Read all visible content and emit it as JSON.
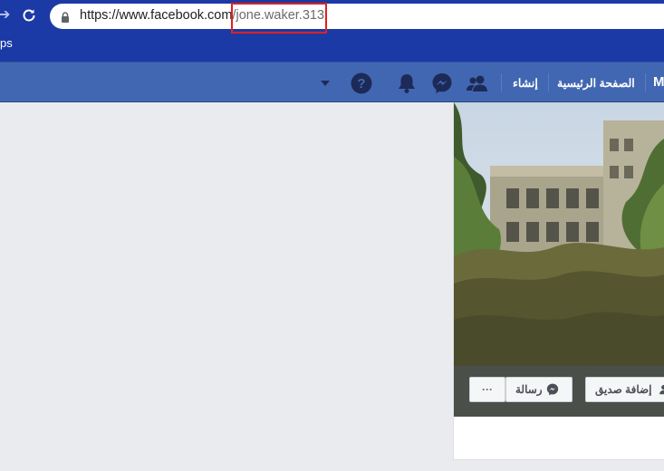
{
  "browser": {
    "url_domain": "https://www.facebook.com",
    "url_path": "/jone.waker.313",
    "bookmarks_label": "ps"
  },
  "fb_nav": {
    "user_initial": "M",
    "home_label": "الصفحة الرئيسية",
    "create_label": "إنشاء",
    "icons": [
      "friends-icon",
      "messenger-icon",
      "notifications-icon",
      "help-icon",
      "dropdown-caret-icon"
    ]
  },
  "profile": {
    "add_friend_label": "إضافة صديق",
    "message_label": "رسالة",
    "more_label": "···"
  },
  "colors": {
    "browser_chrome": "#1c3aa6",
    "fb_blue": "#4267b2",
    "highlight_box": "#e02020",
    "page_bg": "#e9ebee"
  }
}
